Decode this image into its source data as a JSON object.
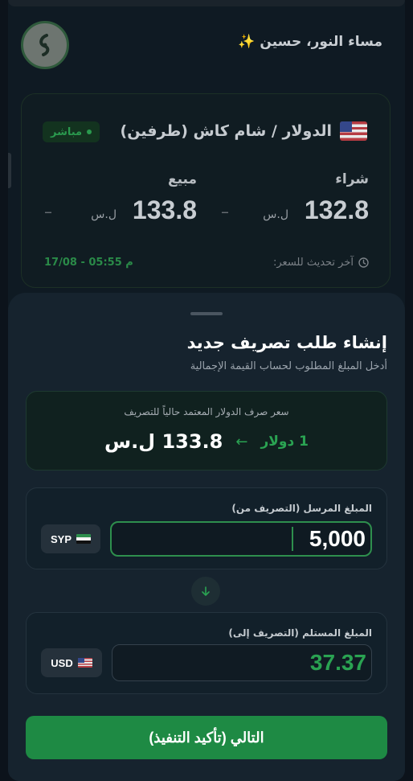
{
  "header": {
    "greeting": "مساء النور، حسين ✨"
  },
  "rate_card": {
    "title": "الدولار / شام كاش (طرفين)",
    "live_badge": "مباشر",
    "buy_label": "شراء",
    "buy_price": "132.8",
    "sell_label": "مبيع",
    "sell_price": "133.8",
    "currency_unit": "ل.س",
    "change_placeholder": "–",
    "last_update_label": "آخر تحديث للسعر:",
    "last_update_time": "17/08 - 05:55 م"
  },
  "sheet": {
    "title": "إنشاء طلب تصريف جديد",
    "subtitle": "أدخل المبلغ المطلوب لحساب القيمة الإجمالية",
    "rate_caption": "سعر صرف الدولار المعتمد حالياً للتصريف",
    "rate_one": "1 دولار",
    "rate_value": "133.8 ل.س",
    "send_label": "المبلغ المرسل (التصريف من)",
    "send_amount": "5,000",
    "send_currency": "SYP",
    "receive_label": "المبلغ المستلم (التصريف إلى)",
    "receive_amount": "37.37",
    "receive_currency": "USD",
    "next_button": "التالي (تأكيد التنفيذ)"
  },
  "colors": {
    "accent_green": "#2aa352",
    "button_green": "#1e8a44",
    "background": "#0f1a23"
  }
}
